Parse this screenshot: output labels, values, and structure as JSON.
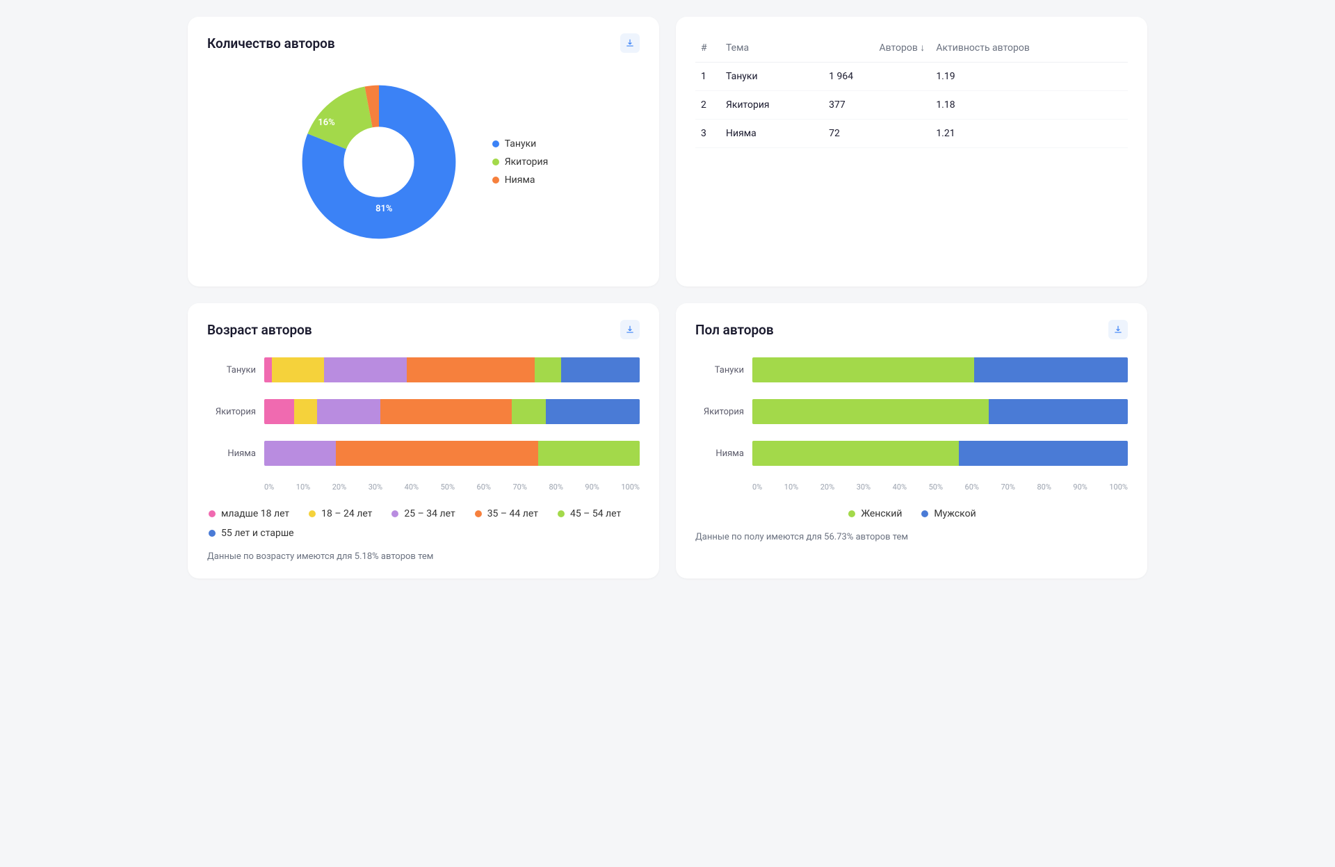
{
  "colors": {
    "blue": "#3b82f6",
    "green": "#a3d94a",
    "orange": "#f6803d",
    "purple": "#b98ce0",
    "yellow": "#f5d23b",
    "pink": "#f06ab0",
    "darkblue": "#4a7bd6"
  },
  "donut_card": {
    "title": "Количество авторов",
    "legend": [
      "Тануки",
      "Якитория",
      "Нияма"
    ],
    "labels": {
      "big": "81%",
      "small": "16%"
    }
  },
  "table_card": {
    "headers": {
      "num": "#",
      "topic": "Тема",
      "authors": "Авторов ↓",
      "activity": "Активность авторов"
    },
    "rows": [
      {
        "n": "1",
        "topic": "Тануки",
        "authors": "1 964",
        "activity": "1.19"
      },
      {
        "n": "2",
        "topic": "Якитория",
        "authors": "377",
        "activity": "1.18"
      },
      {
        "n": "3",
        "topic": "Нияма",
        "authors": "72",
        "activity": "1.21"
      }
    ]
  },
  "age_card": {
    "title": "Возраст авторов",
    "legend": [
      "младше 18 лет",
      "18 – 24 лет",
      "25 – 34 лет",
      "35 – 44 лет",
      "45 – 54 лет",
      "55 лет и старше"
    ],
    "footnote": "Данные по возрасту имеются для 5.18% авторов тем",
    "rows": [
      "Тануки",
      "Якитория",
      "Нияма"
    ]
  },
  "gender_card": {
    "title": "Пол авторов",
    "legend": [
      "Женский",
      "Мужской"
    ],
    "footnote": "Данные по полу имеются для 56.73% авторов тем",
    "rows": [
      "Тануки",
      "Якитория",
      "Нияма"
    ]
  },
  "axis_ticks": [
    "0%",
    "10%",
    "20%",
    "30%",
    "40%",
    "50%",
    "60%",
    "70%",
    "80%",
    "90%",
    "100%"
  ],
  "chart_data": [
    {
      "type": "pie",
      "title": "Количество авторов",
      "series": [
        {
          "name": "Тануки",
          "value": 81
        },
        {
          "name": "Якитория",
          "value": 16
        },
        {
          "name": "Нияма",
          "value": 3
        }
      ]
    },
    {
      "type": "table",
      "title": "Авторы по темам",
      "columns": [
        "#",
        "Тема",
        "Авторов",
        "Активность авторов"
      ],
      "rows": [
        [
          1,
          "Тануки",
          1964,
          1.19
        ],
        [
          2,
          "Якитория",
          377,
          1.18
        ],
        [
          3,
          "Нияма",
          72,
          1.21
        ]
      ]
    },
    {
      "type": "bar",
      "subtype": "stacked-horizontal-percent",
      "title": "Возраст авторов",
      "xlabel": "%",
      "xlim": [
        0,
        100
      ],
      "categories": [
        "Тануки",
        "Якитория",
        "Нияма"
      ],
      "series": [
        {
          "name": "младше 18 лет",
          "values": [
            2,
            8,
            0
          ]
        },
        {
          "name": "18 – 24 лет",
          "values": [
            14,
            6,
            0
          ]
        },
        {
          "name": "25 – 34 лет",
          "values": [
            22,
            17,
            19
          ]
        },
        {
          "name": "35 – 44 лет",
          "values": [
            34,
            35,
            54
          ]
        },
        {
          "name": "45 – 54 лет",
          "values": [
            7,
            9,
            27
          ]
        },
        {
          "name": "55 лет и старше",
          "values": [
            21,
            25,
            0
          ]
        }
      ]
    },
    {
      "type": "bar",
      "subtype": "stacked-horizontal-percent",
      "title": "Пол авторов",
      "xlabel": "%",
      "xlim": [
        0,
        100
      ],
      "categories": [
        "Тануки",
        "Якитория",
        "Нияма"
      ],
      "series": [
        {
          "name": "Женский",
          "values": [
            59,
            63,
            55
          ]
        },
        {
          "name": "Мужской",
          "values": [
            41,
            37,
            45
          ]
        }
      ]
    }
  ]
}
